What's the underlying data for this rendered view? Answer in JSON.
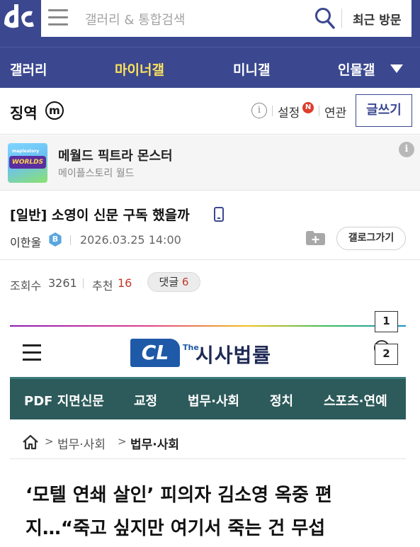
{
  "header": {
    "logo_icon": "dc-logo-icon",
    "menu_icon": "hamburger-icon",
    "search_placeholder": "갤러리 & 통합검색",
    "search_icon": "search-icon",
    "recent_visit_label": "최근 방문",
    "brand_color": "#3b4890"
  },
  "nav": {
    "items": [
      {
        "label": "갤러리",
        "active": false
      },
      {
        "label": "마이너갤",
        "active": true
      },
      {
        "label": "미니갤",
        "active": false
      },
      {
        "label": "인물갤",
        "active": false
      }
    ],
    "more_icon": "caret-down-icon",
    "active_color": "#ffe35a"
  },
  "gallery": {
    "name": "징역",
    "type_badge": "m",
    "info_icon": "info-icon",
    "settings_label": "설정",
    "new_badge": "N",
    "related_label": "연관",
    "write_button": "글쓰기"
  },
  "banner": {
    "game_title": "메월드 픽트라 몬스터",
    "game_subtitle": "메이플스토리 월드",
    "thumbnail_small": "maplestory",
    "thumbnail_text": "WORLDS",
    "info_icon": "info-icon"
  },
  "post": {
    "category": "[일반]",
    "title": "소영이 신문 구독 했을까",
    "device_icon": "mobile-icon",
    "author": "이한울",
    "author_badge": "B",
    "date": "2026.03.25 14:00",
    "scrap_icon": "folder-add-icon",
    "gallery_back_button": "갤로그가기"
  },
  "stats": {
    "views_label": "조회수",
    "views": "3261",
    "recommend_label": "추천",
    "recommend": "16",
    "comments_label": "댓글",
    "comments": "6",
    "count_color": "#c0392b"
  },
  "embed": {
    "badge_1": "1",
    "badge_2": "2",
    "logo_mark": "CL",
    "logo_the": "The",
    "logo_name": "시사법률",
    "nav": [
      "PDF 지면신문",
      "교정",
      "법무·사회",
      "정치",
      "스포츠·연예"
    ],
    "breadcrumb": [
      "법무·사회",
      "법무·사회"
    ],
    "headline": "‘모텔 연쇄 살인’ 피의자 김소영 옥중 편지…“죽고 싶지만 여기서 죽는 건 무섭",
    "nav_color": "#2d5a5a"
  }
}
